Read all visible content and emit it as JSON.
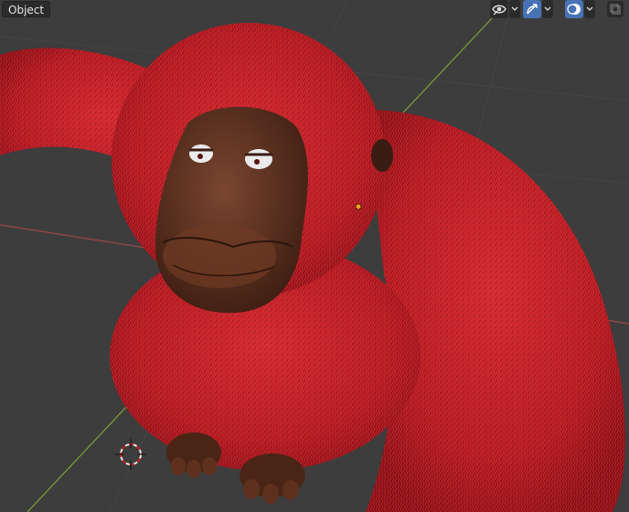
{
  "header": {
    "mode_label": "Object"
  },
  "toolbar": {
    "visibility_icon": "eye-icon",
    "gizmo_icon": "gizmo-icon",
    "overlay_icon": "overlay-icon",
    "xray_icon": "xray-icon"
  },
  "colors": {
    "viewport_bg": "#3d3d3d",
    "fur": "#b81a22",
    "skin": "#5a2e1c",
    "x_axis": "#a04848",
    "y_axis": "#7fa03a",
    "active_button": "#4772b3"
  }
}
